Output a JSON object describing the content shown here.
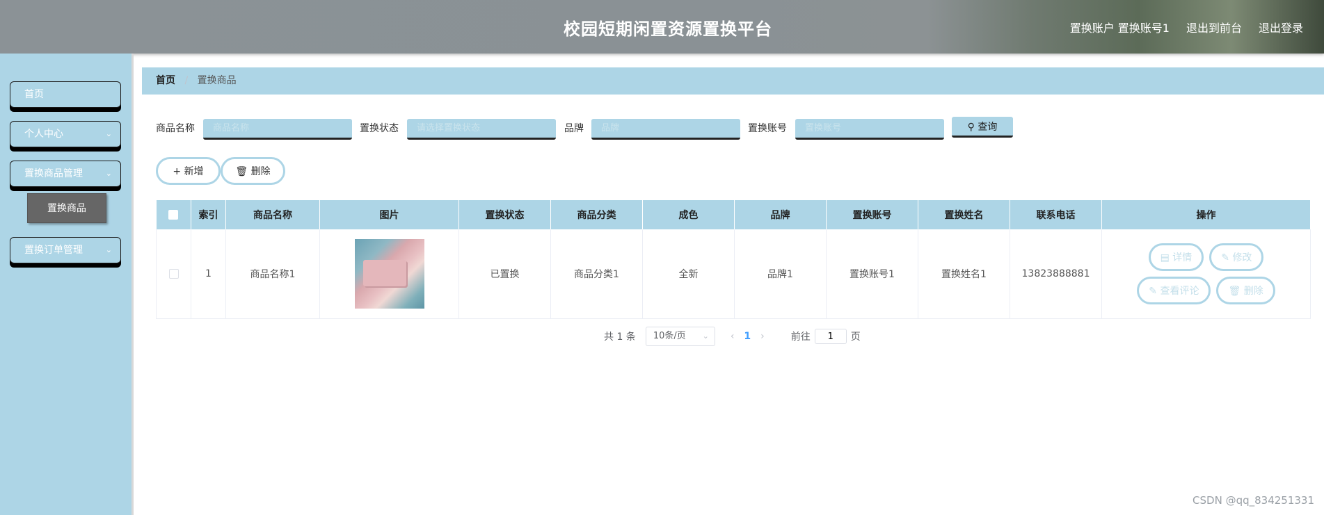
{
  "header": {
    "title": "校园短期闲置资源置换平台",
    "account": "置换账户 置换账号1",
    "to_front": "退出到前台",
    "logout": "退出登录"
  },
  "sidebar": {
    "items": [
      {
        "label": "首页"
      },
      {
        "label": "个人中心"
      },
      {
        "label": "置换商品管理"
      },
      {
        "label": "置换订单管理"
      }
    ],
    "sub_item": "置换商品"
  },
  "breadcrumb": {
    "home": "首页",
    "separator": "/",
    "current": "置换商品"
  },
  "search": {
    "fields": [
      {
        "label": "商品名称",
        "placeholder": "商品名称"
      },
      {
        "label": "置换状态",
        "placeholder": "请选择置换状态"
      },
      {
        "label": "品牌",
        "placeholder": "品牌"
      },
      {
        "label": "置换账号",
        "placeholder": "置换账号"
      }
    ],
    "button": "查询"
  },
  "actions": {
    "add": "新增",
    "delete": "删除"
  },
  "table": {
    "headers": [
      "索引",
      "商品名称",
      "图片",
      "置换状态",
      "商品分类",
      "成色",
      "品牌",
      "置换账号",
      "置换姓名",
      "联系电话",
      "操作"
    ],
    "rows": [
      {
        "index": "1",
        "name": "商品名称1",
        "status": "已置换",
        "category": "商品分类1",
        "condition": "全新",
        "brand": "品牌1",
        "account": "置换账号1",
        "person": "置换姓名1",
        "phone": "13823888881"
      }
    ],
    "ops": {
      "detail": "详情",
      "edit": "修改",
      "comments": "查看评论",
      "delete": "删除"
    }
  },
  "pagination": {
    "total": "共 1 条",
    "page_size": "10条/页",
    "current": "1",
    "goto_prefix": "前往",
    "goto_value": "1",
    "goto_suffix": "页"
  },
  "watermark": "CSDN @qq_834251331",
  "colors": {
    "accent": "#add5e6",
    "header": "#8b9296",
    "submenu": "#666666"
  }
}
